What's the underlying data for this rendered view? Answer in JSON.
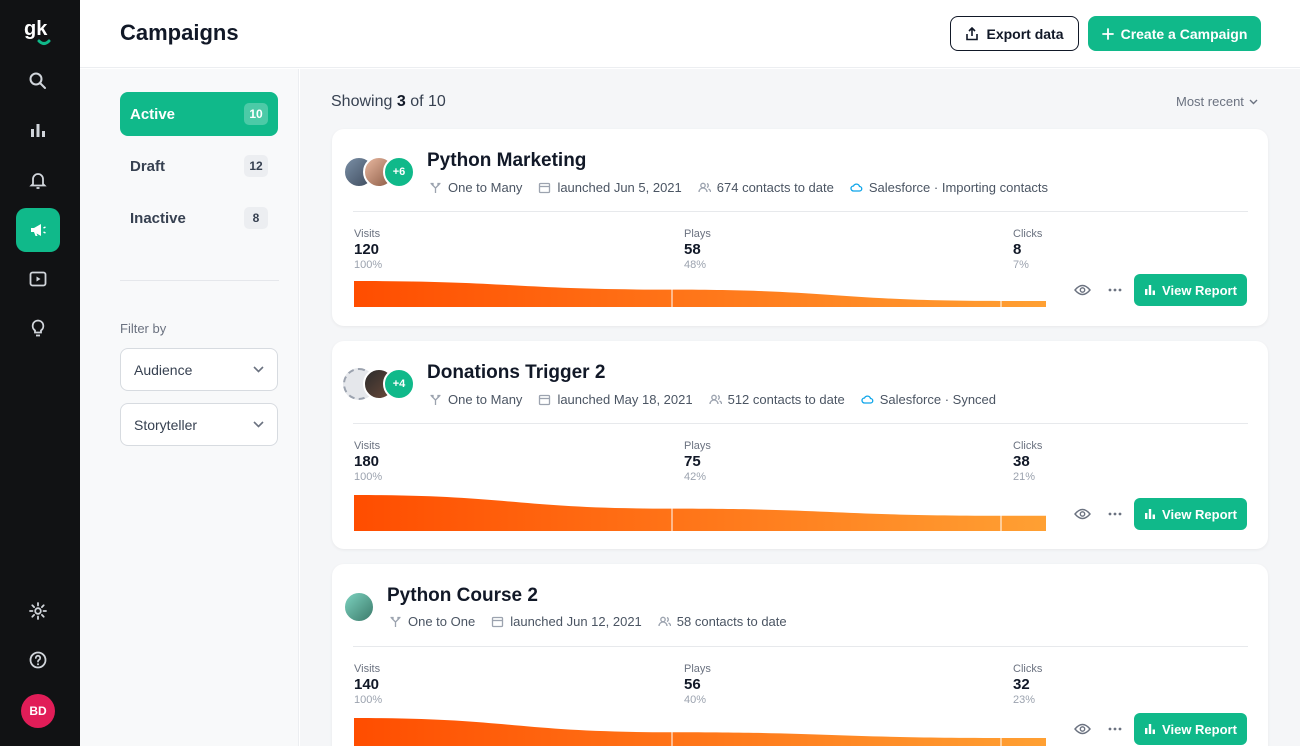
{
  "app": {
    "logo_text": "gk",
    "user_initials": "BD"
  },
  "sidebar": {
    "items": [
      {
        "icon": "search-icon"
      },
      {
        "icon": "bar-chart-icon"
      },
      {
        "icon": "bell-icon"
      },
      {
        "icon": "megaphone-icon",
        "active": true
      },
      {
        "icon": "video-icon"
      },
      {
        "icon": "lightbulb-icon"
      }
    ],
    "bottom": [
      {
        "icon": "gear-icon"
      },
      {
        "icon": "help-icon"
      }
    ]
  },
  "header": {
    "title": "Campaigns",
    "export_label": "Export data",
    "create_label": "Create a Campaign"
  },
  "statuses": [
    {
      "label": "Active",
      "count": "10",
      "active": true
    },
    {
      "label": "Draft",
      "count": "12"
    },
    {
      "label": "Inactive",
      "count": "8"
    }
  ],
  "filters": {
    "label": "Filter by",
    "audience": "Audience",
    "storyteller": "Storyteller"
  },
  "listing": {
    "showing_prefix": "Showing",
    "shown": "3",
    "showing_mid": "of",
    "total": "10",
    "sort": "Most recent"
  },
  "campaigns": [
    {
      "title": "Python Marketing",
      "extra_avatars": "+6",
      "type": "One to Many",
      "launched": "launched Jun 5, 2021",
      "contacts": "674 contacts to date",
      "integration": "Salesforce · Importing contacts",
      "visits_label": "Visits",
      "visits": "120",
      "visits_pct": "100%",
      "plays_label": "Plays",
      "plays": "58",
      "plays_pct": "48%",
      "clicks_label": "Clicks",
      "clicks": "8",
      "clicks_pct": "7%",
      "funnel": [
        1.0,
        0.48,
        0.07
      ],
      "view_label": "View Report"
    },
    {
      "title": "Donations Trigger 2",
      "extra_avatars": "+4",
      "type": "One to Many",
      "launched": "launched May 18, 2021",
      "contacts": "512 contacts to date",
      "integration": "Salesforce · Synced",
      "visits_label": "Visits",
      "visits": "180",
      "visits_pct": "100%",
      "plays_label": "Plays",
      "plays": "75",
      "plays_pct": "42%",
      "clicks_label": "Clicks",
      "clicks": "38",
      "clicks_pct": "21%",
      "funnel": [
        1.0,
        0.42,
        0.21
      ],
      "view_label": "View Report"
    },
    {
      "title": "Python Course 2",
      "type": "One to One",
      "launched": "launched Jun 12, 2021",
      "contacts": "58 contacts to date",
      "visits_label": "Visits",
      "visits": "140",
      "visits_pct": "100%",
      "plays_label": "Plays",
      "plays": "56",
      "plays_pct": "40%",
      "clicks_label": "Clicks",
      "clicks": "32",
      "clicks_pct": "23%",
      "funnel": [
        1.0,
        0.4,
        0.23
      ],
      "view_label": "View Report"
    }
  ],
  "colors": {
    "accent": "#10b98a",
    "funnel_start": "#ff4d00",
    "funnel_end": "#ffa033",
    "sidebar": "#111214"
  }
}
